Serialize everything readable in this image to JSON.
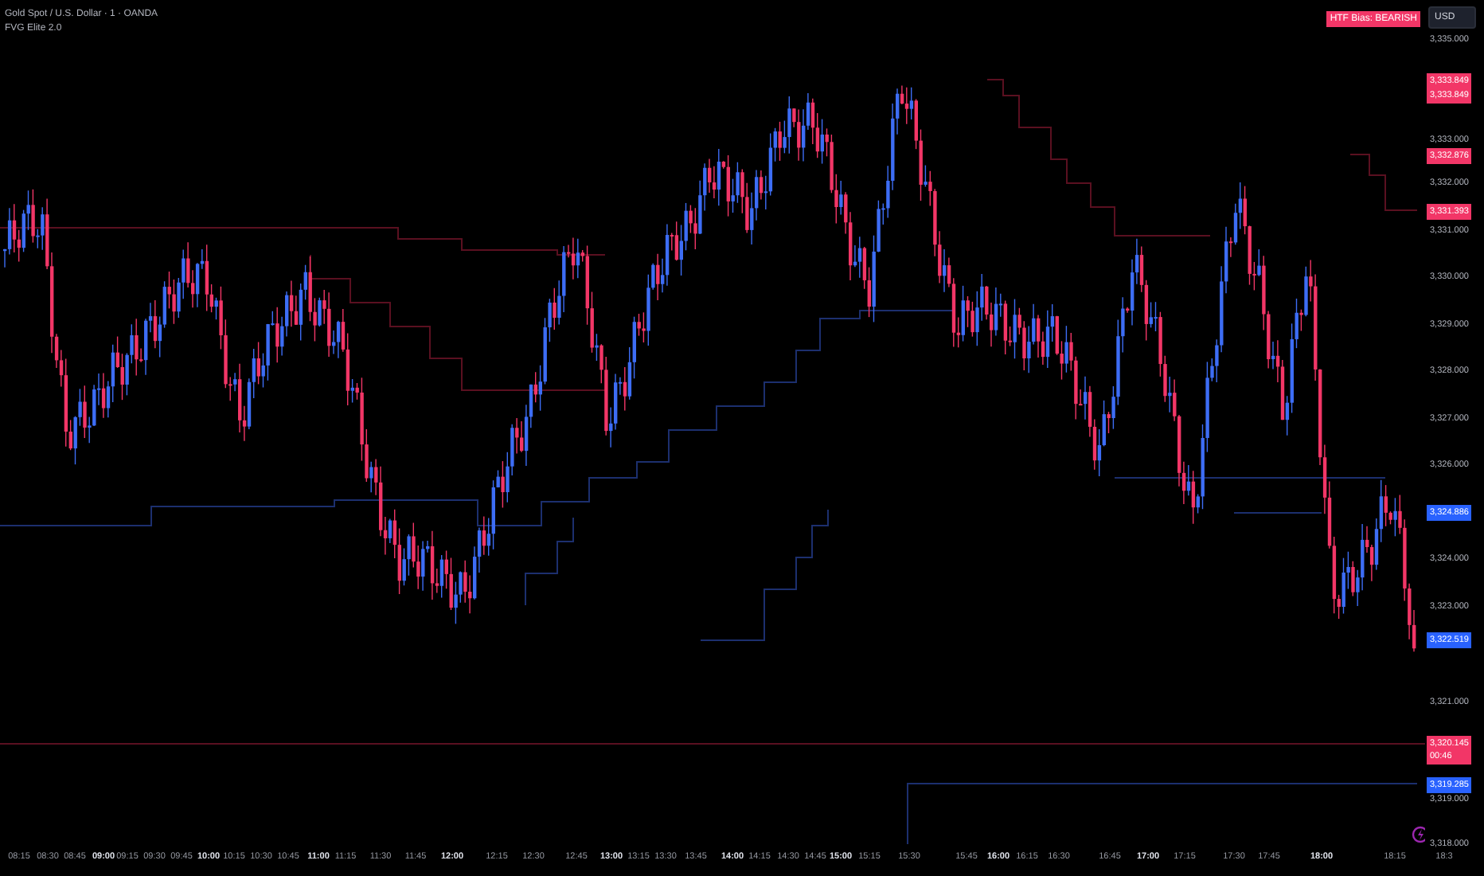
{
  "symbol_title": "Gold Spot / U.S. Dollar · 1 · OANDA",
  "indicator_name": "FVG Elite 2.0",
  "bias_badge": "HTF Bias: BEARISH",
  "currency_button": "USD",
  "price_axis": [
    {
      "kind": "tick",
      "label": "3,335.000"
    },
    {
      "kind": "tag",
      "label": "3,333.849",
      "color": "#f23667"
    },
    {
      "kind": "tag",
      "label": "3,333.849",
      "color": "#f23667"
    },
    {
      "kind": "tick",
      "label": "3,333.000"
    },
    {
      "kind": "tag",
      "label": "3,332.876",
      "color": "#f23667"
    },
    {
      "kind": "tick",
      "label": "3,332.000"
    },
    {
      "kind": "tag",
      "label": "3,331.393",
      "color": "#f23667"
    },
    {
      "kind": "tick",
      "label": "3,331.000"
    },
    {
      "kind": "tick",
      "label": "3,330.000"
    },
    {
      "kind": "tick",
      "label": "3,329.000"
    },
    {
      "kind": "tick",
      "label": "3,328.000"
    },
    {
      "kind": "tick",
      "label": "3,327.000"
    },
    {
      "kind": "tick",
      "label": "3,326.000"
    },
    {
      "kind": "tag",
      "label": "3,324.886",
      "color": "#2962ff"
    },
    {
      "kind": "tick",
      "label": "3,324.000"
    },
    {
      "kind": "tick",
      "label": "3,323.000"
    },
    {
      "kind": "tag",
      "label": "3,322.519",
      "color": "#2962ff"
    },
    {
      "kind": "tick",
      "label": "3,321.000"
    },
    {
      "kind": "tag",
      "label": "3,320.145",
      "countdown": "00:46",
      "color": "#f23667"
    },
    {
      "kind": "tag",
      "label": "3,319.285",
      "color": "#2962ff"
    },
    {
      "kind": "tick",
      "label": "3,319.000"
    },
    {
      "kind": "tick",
      "label": "3,318.000"
    }
  ],
  "time_axis": [
    {
      "label": "08:15",
      "major": false
    },
    {
      "label": "08:30",
      "major": false
    },
    {
      "label": "08:45",
      "major": false
    },
    {
      "label": "09:00",
      "major": true
    },
    {
      "label": "09:15",
      "major": false
    },
    {
      "label": "09:30",
      "major": false
    },
    {
      "label": "09:45",
      "major": false
    },
    {
      "label": "10:00",
      "major": true
    },
    {
      "label": "10:15",
      "major": false
    },
    {
      "label": "10:30",
      "major": false
    },
    {
      "label": "10:45",
      "major": false
    },
    {
      "label": "11:00",
      "major": true
    },
    {
      "label": "11:15",
      "major": false
    },
    {
      "label": "11:30",
      "major": false
    },
    {
      "label": "11:45",
      "major": false
    },
    {
      "label": "12:00",
      "major": true
    },
    {
      "label": "12:15",
      "major": false
    },
    {
      "label": "12:30",
      "major": false
    },
    {
      "label": "12:45",
      "major": false
    },
    {
      "label": "13:00",
      "major": true
    },
    {
      "label": "13:15",
      "major": false
    },
    {
      "label": "13:30",
      "major": false
    },
    {
      "label": "13:45",
      "major": false
    },
    {
      "label": "14:00",
      "major": true
    },
    {
      "label": "14:15",
      "major": false
    },
    {
      "label": "14:30",
      "major": false
    },
    {
      "label": "14:45",
      "major": false
    },
    {
      "label": "15:00",
      "major": true
    },
    {
      "label": "15:15",
      "major": false
    },
    {
      "label": "15:30",
      "major": false
    },
    {
      "label": "15:45",
      "major": false
    },
    {
      "label": "16:00",
      "major": true
    },
    {
      "label": "16:15",
      "major": false
    },
    {
      "label": "16:30",
      "major": false
    },
    {
      "label": "16:45",
      "major": false
    },
    {
      "label": "17:00",
      "major": true
    },
    {
      "label": "17:15",
      "major": false
    },
    {
      "label": "17:30",
      "major": false
    },
    {
      "label": "17:45",
      "major": false
    },
    {
      "label": "18:00",
      "major": true
    },
    {
      "label": "18:15",
      "major": false
    },
    {
      "label": "18:3",
      "major": false
    }
  ]
}
